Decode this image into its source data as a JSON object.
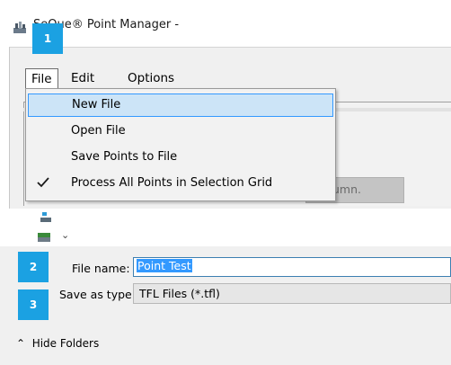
{
  "window": {
    "title": "SeQue® Point Manager -"
  },
  "menubar": {
    "file": "File",
    "edit": "Edit",
    "options": "Options"
  },
  "file_menu": {
    "items": [
      {
        "label": "New File",
        "highlighted": true
      },
      {
        "label": "Open File"
      },
      {
        "label": "Save Points to File"
      },
      {
        "label": "Process All Points in Selection Grid",
        "checked": true
      }
    ]
  },
  "background": {
    "obscured_text": "column."
  },
  "save_dialog": {
    "file_name_label": "File name:",
    "file_name_value": "Point Test",
    "save_as_type_label": "Save as type:",
    "save_as_type_value": "TFL Files (*.tfl)",
    "hide_folders_label": "Hide Folders"
  },
  "badges": [
    "1",
    "2",
    "3"
  ],
  "colors": {
    "badge": "#1ba1e2",
    "highlight": "#cce4f7",
    "selection": "#3399ff"
  }
}
